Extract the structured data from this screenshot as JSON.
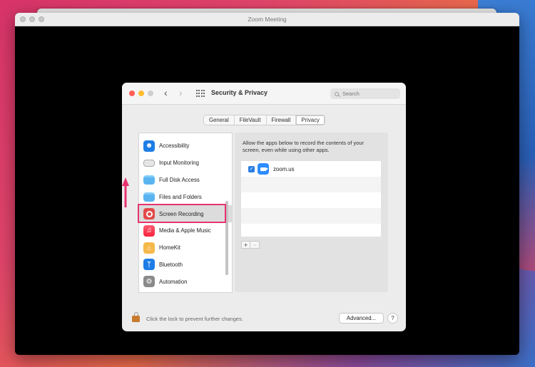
{
  "zoom_window": {
    "title": "Zoom Meeting"
  },
  "prefs": {
    "title": "Security & Privacy",
    "search_placeholder": "Search",
    "tabs": [
      {
        "label": "General"
      },
      {
        "label": "FileVault"
      },
      {
        "label": "Firewall"
      },
      {
        "label": "Privacy"
      }
    ],
    "active_tab": "Privacy",
    "sidebar": [
      {
        "label": "Accessibility",
        "icon": "accessibility-icon"
      },
      {
        "label": "Input Monitoring",
        "icon": "keyboard-icon"
      },
      {
        "label": "Full Disk Access",
        "icon": "folder-icon"
      },
      {
        "label": "Files and Folders",
        "icon": "folder-icon"
      },
      {
        "label": "Screen Recording",
        "icon": "screen-recording-icon"
      },
      {
        "label": "Media & Apple Music",
        "icon": "music-icon"
      },
      {
        "label": "HomeKit",
        "icon": "home-icon"
      },
      {
        "label": "Bluetooth",
        "icon": "bluetooth-icon"
      },
      {
        "label": "Automation",
        "icon": "gear-icon"
      }
    ],
    "selected_item": "Screen Recording",
    "description": "Allow the apps below to record the contents of your screen, even while using other apps.",
    "apps": [
      {
        "name": "zoom.us",
        "checked": true
      }
    ],
    "add_label": "+",
    "remove_label": "−",
    "footer_text": "Click the lock to prevent further changes.",
    "advanced_label": "Advanced...",
    "help_label": "?"
  },
  "colors": {
    "highlight": "#e6336e",
    "accent": "#2a7de0",
    "zoom_blue": "#2d8cff"
  }
}
